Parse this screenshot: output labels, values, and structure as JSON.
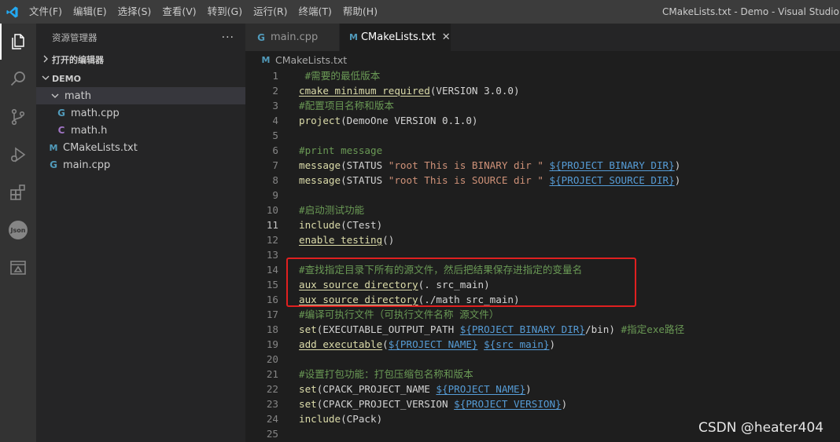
{
  "titlebar": {
    "menu": [
      "文件(F)",
      "编辑(E)",
      "选择(S)",
      "查看(V)",
      "转到(G)",
      "运行(R)",
      "终端(T)",
      "帮助(H)"
    ],
    "window_title": "CMakeLists.txt - Demo - Visual Studio Code"
  },
  "activity_bar": {
    "icons": [
      "explorer-icon",
      "search-icon",
      "source-control-icon",
      "run-debug-icon",
      "extensions-icon",
      "json-icon",
      "remote-explorer-icon"
    ],
    "json_label": "Json"
  },
  "sidebar": {
    "header": "资源管理器",
    "more": "···",
    "open_editors": "打开的编辑器",
    "project": "DEMO",
    "tree": [
      {
        "name": "math",
        "type": "folder",
        "expanded": true
      },
      {
        "name": "math.cpp",
        "type": "cpp",
        "icon_letter": "G"
      },
      {
        "name": "math.h",
        "type": "h",
        "icon_letter": "C"
      },
      {
        "name": "CMakeLists.txt",
        "type": "cmake",
        "icon_letter": "M"
      },
      {
        "name": "main.cpp",
        "type": "cpp",
        "icon_letter": "G"
      }
    ]
  },
  "tabs": [
    {
      "label": "main.cpp",
      "active": false,
      "icon_letter": "G"
    },
    {
      "label": "CMakeLists.txt",
      "active": true,
      "icon_letter": "M",
      "close": "✕"
    }
  ],
  "breadcrumb": {
    "file": "CMakeLists.txt",
    "icon_letter": "M"
  },
  "editor": {
    "current_line": 11,
    "lines": [
      {
        "n": "1",
        "code": " #需要的最低版本"
      },
      {
        "n": "2",
        "code": "cmake_minimum_required(VERSION 3.0.0)"
      },
      {
        "n": "3",
        "code": "#配置项目名称和版本"
      },
      {
        "n": "4",
        "code": "project(DemoOne VERSION 0.1.0)"
      },
      {
        "n": "5",
        "code": ""
      },
      {
        "n": "6",
        "code": "#print message"
      },
      {
        "n": "7",
        "code": "message(STATUS \"root This is BINARY dir \" ${PROJECT_BINARY_DIR})"
      },
      {
        "n": "8",
        "code": "message(STATUS \"root This is SOURCE dir \" ${PROJECT_SOURCE_DIR})"
      },
      {
        "n": "9",
        "code": ""
      },
      {
        "n": "10",
        "code": "#启动测试功能"
      },
      {
        "n": "11",
        "code": "include(CTest)"
      },
      {
        "n": "12",
        "code": "enable_testing()"
      },
      {
        "n": "13",
        "code": ""
      },
      {
        "n": "14",
        "code": "#查找指定目录下所有的源文件，然后把结果保存进指定的变量名"
      },
      {
        "n": "15",
        "code": "aux_source_directory(. src_main)"
      },
      {
        "n": "16",
        "code": "aux_source_directory(./math src_main)"
      },
      {
        "n": "17",
        "code": "#编译可执行文件（可执行文件名称 源文件）"
      },
      {
        "n": "18",
        "code": "set(EXECUTABLE_OUTPUT_PATH ${PROJECT_BINARY_DIR}/bin) #指定exe路径"
      },
      {
        "n": "19",
        "code": "add_executable(${PROJECT_NAME} ${src_main})"
      },
      {
        "n": "20",
        "code": ""
      },
      {
        "n": "21",
        "code": "#设置打包功能：打包压缩包名称和版本"
      },
      {
        "n": "22",
        "code": "set(CPACK_PROJECT_NAME ${PROJECT_NAME})"
      },
      {
        "n": "23",
        "code": "set(CPACK_PROJECT_VERSION ${PROJECT_VERSION})"
      },
      {
        "n": "24",
        "code": "include(CPack)"
      },
      {
        "n": "25",
        "code": ""
      }
    ]
  },
  "watermark": "CSDN @heater404",
  "colors": {
    "accent": "#007acc",
    "highlight_box": "#e02020",
    "comment": "#6a9955",
    "function": "#dcdcaa",
    "string": "#ce9178",
    "variable": "#569cd6"
  }
}
